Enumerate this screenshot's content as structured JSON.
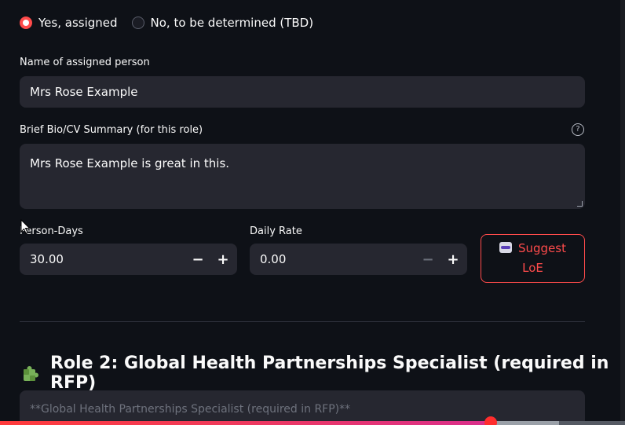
{
  "assignment": {
    "options": [
      {
        "label": "Yes, assigned",
        "selected": true
      },
      {
        "label": "No, to be determined (TBD)",
        "selected": false
      }
    ]
  },
  "name_field": {
    "label": "Name of assigned person",
    "value": "Mrs Rose Example"
  },
  "bio_field": {
    "label": "Brief Bio/CV Summary (for this role)",
    "value": "Mrs Rose Example is great in this.",
    "help_icon": "question-circle-icon"
  },
  "person_days": {
    "label": "Person-Days",
    "value": "30.00",
    "minus": "−",
    "plus": "+"
  },
  "daily_rate": {
    "label": "Daily Rate",
    "value": "0.00",
    "minus": "−",
    "plus": "+"
  },
  "suggest_button": {
    "icon": "robot-icon",
    "label_line1": "Suggest",
    "label_line2": "LoE"
  },
  "role2": {
    "icon": "puzzle-piece-icon",
    "title": "Role 2: Global Health Partnerships Specialist (required in RFP)",
    "text_value": "**Global Health Partnerships Specialist (required in RFP)**"
  },
  "video_progress": {
    "played_fraction": 0.785,
    "buffered_fraction": 0.895
  },
  "colors": {
    "accent": "#ff4b4b",
    "background": "#0e1117",
    "input_bg": "#262730"
  }
}
